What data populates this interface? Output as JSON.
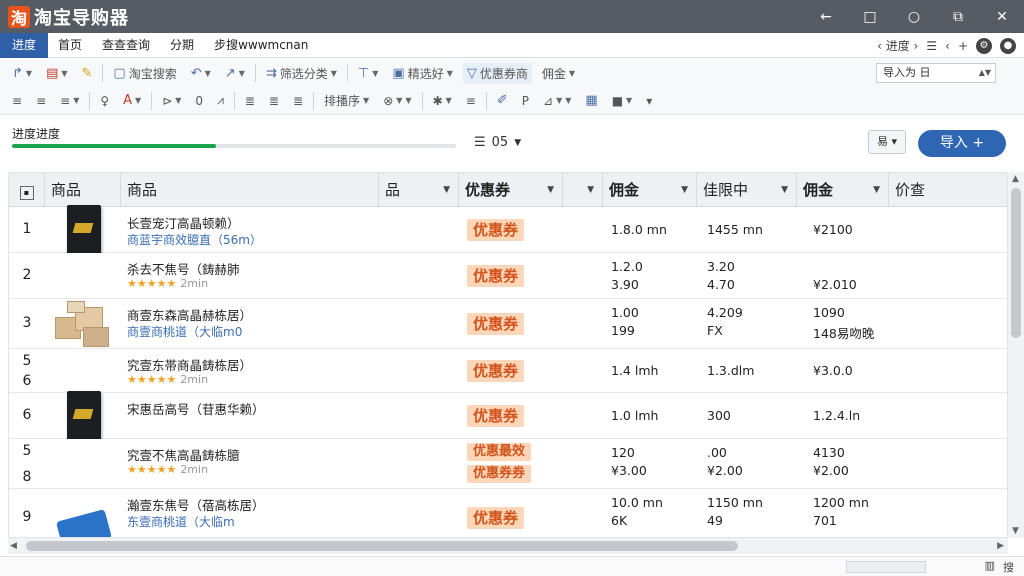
{
  "window": {
    "logo": "淘",
    "title": "淘宝导购器",
    "controls": [
      "←",
      "□",
      "○",
      "⧉",
      "✕"
    ]
  },
  "menu": {
    "items": [
      "进度",
      "首页",
      "查查查询",
      "分期",
      "步搜wwwmcnan"
    ],
    "right": [
      "‹ 进度 ›",
      "☰",
      "‹",
      "+"
    ]
  },
  "toolbar1": {
    "items": [
      {
        "icon": "↱",
        "label": "",
        "caret": true
      },
      {
        "icon": "▤",
        "label": "",
        "caret": true
      },
      {
        "icon": "✎",
        "label": ""
      },
      {
        "icon": "▢",
        "label": "淘宝搜索"
      },
      {
        "icon": "↶",
        "label": "",
        "caret": true
      },
      {
        "icon": "↗",
        "label": "",
        "caret": true
      },
      {
        "icon": "⇉",
        "label": "筛选分类",
        "caret": true
      },
      {
        "icon": "⊤",
        "label": "",
        "caret": true
      },
      {
        "icon": "▣",
        "label": "精选好",
        "caret": true
      },
      {
        "icon": "▽",
        "label": "优惠券商"
      },
      {
        "icon": "",
        "label": "佣金",
        "caret": true
      }
    ],
    "date_select": "导入为 日"
  },
  "toolbar2": {
    "items": [
      {
        "icon": "≡"
      },
      {
        "icon": "≡"
      },
      {
        "icon": "≡"
      },
      {
        "icon": "♀"
      },
      {
        "icon": "A",
        "color": "red"
      },
      {
        "icon": "⊳"
      },
      {
        "icon": "0"
      },
      {
        "icon": "⩘"
      },
      {
        "icon": "≣"
      },
      {
        "icon": "≣"
      },
      {
        "icon": "≣"
      },
      {
        "icon": "",
        "label": "排播序"
      },
      {
        "icon": "⊗"
      },
      {
        "icon": "✱"
      },
      {
        "icon": "≡"
      },
      {
        "icon": "✐"
      },
      {
        "icon": "P"
      },
      {
        "icon": "⊿"
      },
      {
        "icon": "▦"
      },
      {
        "icon": "■"
      },
      {
        "icon": "▾"
      }
    ]
  },
  "progress": {
    "label": "进度进度",
    "value": 0.46
  },
  "sort": {
    "label": "05",
    "icon": "☰"
  },
  "small_dropdown": "易 ▾",
  "import_button": "导入 +",
  "table": {
    "headers": [
      "商品",
      "商品",
      "品",
      "优惠券",
      "佣金",
      "佳限中",
      "佣金",
      "价查"
    ],
    "rows": [
      {
        "nums": [
          "1"
        ],
        "thumb": "book",
        "name": "长壹宠汀高晶顿赖）",
        "sub": "商蓝宇商效臆直（56m）",
        "stars": "",
        "meta": "",
        "coupons": [
          "优惠券"
        ],
        "c1": [
          "1.8.0 mn"
        ],
        "c2": [
          "1455 mn"
        ],
        "c3": [
          "¥2100"
        ]
      },
      {
        "nums": [
          "2"
        ],
        "thumb": "",
        "name": "杀去不焦号（鋳赫肺",
        "sub": "",
        "stars": "★★★★★",
        "meta": "2min",
        "coupons": [
          "优惠券"
        ],
        "c1": [
          "1.2.0",
          "3.90"
        ],
        "c2": [
          "3.20",
          "4.70"
        ],
        "c3": [
          "",
          "¥2.010"
        ]
      },
      {
        "nums": [
          "3"
        ],
        "thumb": "boxes",
        "name": "商壹东森高晶赫栋居）",
        "sub": "商壹商桃道（大临m0",
        "stars": "",
        "meta": "",
        "coupons": [
          "优惠券"
        ],
        "c1": [
          "1.00",
          "199"
        ],
        "c2": [
          "4.209",
          "FX"
        ],
        "c3": [
          "1090",
          "148易吻晚"
        ]
      },
      {
        "nums": [
          "5",
          "6"
        ],
        "thumb": "",
        "name": "究壹东帯商晶鋳栋居）",
        "sub": "",
        "stars": "★★★★★",
        "meta": "2min",
        "coupons": [
          "优惠券"
        ],
        "c1": [
          "1.4 lmh"
        ],
        "c2": [
          "1.3.dlm"
        ],
        "c3": [
          "¥3.0.0"
        ]
      },
      {
        "nums": [
          "6"
        ],
        "thumb": "book",
        "name": "宋惠岳高号（苷惠华赖）",
        "sub": "",
        "stars": "",
        "meta": "",
        "coupons": [
          "优惠券"
        ],
        "c1": [
          "1.0 lmh"
        ],
        "c2": [
          "300"
        ],
        "c3": [
          "1.2.4.ln"
        ]
      },
      {
        "nums": [
          "5",
          "8"
        ],
        "thumb": "",
        "name": "究壹不焦高晶鋳栋臆",
        "sub": "",
        "stars": "★★★★★",
        "meta": "2min",
        "coupons": [
          "优惠最效",
          "优惠券券"
        ],
        "c1": [
          "120",
          "¥3.00"
        ],
        "c2": [
          ".00",
          "¥2.00"
        ],
        "c3": [
          "4130",
          "¥2.00"
        ]
      },
      {
        "nums": [
          "9"
        ],
        "thumb": "bluebox",
        "name": "瀚壹东焦号（蓓高栋居）",
        "sub": "东壹商桃道（大临m",
        "stars": "",
        "meta": "",
        "coupons": [
          "优惠券"
        ],
        "c1": [
          "10.0 mn",
          "6K"
        ],
        "c2": [
          "1150 mn",
          "49"
        ],
        "c3": [
          "1200 mn",
          "701"
        ]
      }
    ]
  },
  "status": {
    "right": [
      "▥",
      "搜"
    ]
  }
}
